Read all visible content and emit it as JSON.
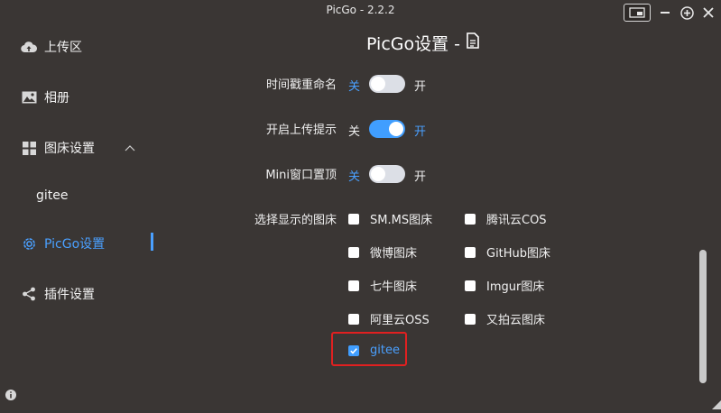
{
  "window": {
    "title": "PicGo - 2.2.2"
  },
  "sidebar": {
    "items": [
      {
        "label": "上传区",
        "icon": "cloud-upload-icon"
      },
      {
        "label": "相册",
        "icon": "image-icon"
      },
      {
        "label": "图床设置",
        "icon": "grid-icon"
      },
      {
        "label": "gitee",
        "icon": ""
      },
      {
        "label": "PicGo设置",
        "icon": "gear-icon"
      },
      {
        "label": "插件设置",
        "icon": "share-icon"
      }
    ]
  },
  "main": {
    "title": "PicGo设置 -",
    "settings": [
      {
        "label": "时间戳重命名",
        "off": "关",
        "on": "开",
        "value": false
      },
      {
        "label": "开启上传提示",
        "off": "关",
        "on": "开",
        "value": true
      },
      {
        "label": "Mini窗口置顶",
        "off": "关",
        "on": "开",
        "value": false
      }
    ],
    "picbed_label": "选择显示的图床",
    "picbeds_left": [
      {
        "label": "SM.MS图床",
        "checked": false
      },
      {
        "label": "微博图床",
        "checked": false
      },
      {
        "label": "七牛图床",
        "checked": false
      },
      {
        "label": "阿里云OSS",
        "checked": false
      },
      {
        "label": "gitee",
        "checked": true
      }
    ],
    "picbeds_right": [
      {
        "label": "腾讯云COS",
        "checked": false
      },
      {
        "label": "GitHub图床",
        "checked": false
      },
      {
        "label": "Imgur图床",
        "checked": false
      },
      {
        "label": "又拍云图床",
        "checked": false
      }
    ]
  },
  "colors": {
    "accent": "#409eff",
    "background": "#3a3634",
    "highlight": "#e02020"
  }
}
